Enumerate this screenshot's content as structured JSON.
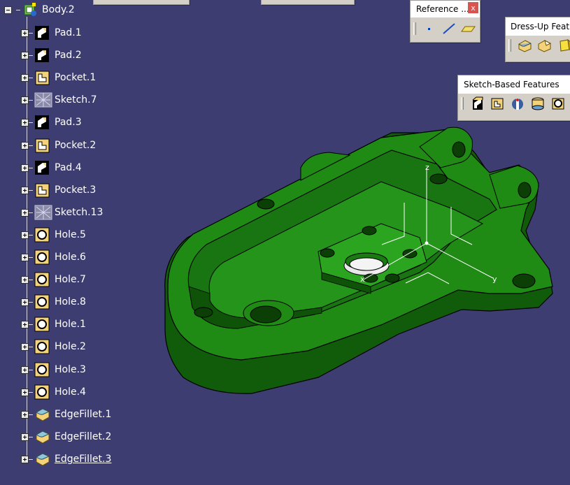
{
  "tree": {
    "root": {
      "label": "Body.2",
      "icon": "body-icon"
    },
    "items": [
      {
        "label": "Pad.1",
        "icon": "pad-icon"
      },
      {
        "label": "Pad.2",
        "icon": "pad-icon"
      },
      {
        "label": "Pocket.1",
        "icon": "pocket-icon"
      },
      {
        "label": "Sketch.7",
        "icon": "sketch-icon"
      },
      {
        "label": "Pad.3",
        "icon": "pad-icon"
      },
      {
        "label": "Pocket.2",
        "icon": "pocket-icon"
      },
      {
        "label": "Pad.4",
        "icon": "pad-icon"
      },
      {
        "label": "Pocket.3",
        "icon": "pocket-icon"
      },
      {
        "label": "Sketch.13",
        "icon": "sketch-icon"
      },
      {
        "label": "Hole.5",
        "icon": "hole-icon"
      },
      {
        "label": "Hole.6",
        "icon": "hole-icon"
      },
      {
        "label": "Hole.7",
        "icon": "hole-icon"
      },
      {
        "label": "Hole.8",
        "icon": "hole-icon"
      },
      {
        "label": "Hole.1",
        "icon": "hole-icon"
      },
      {
        "label": "Hole.2",
        "icon": "hole-icon"
      },
      {
        "label": "Hole.3",
        "icon": "hole-icon"
      },
      {
        "label": "Hole.4",
        "icon": "hole-icon"
      },
      {
        "label": "EdgeFillet.1",
        "icon": "edge-fillet-icon"
      },
      {
        "label": "EdgeFillet.2",
        "icon": "edge-fillet-icon"
      },
      {
        "label": "EdgeFillet.3",
        "icon": "edge-fillet-icon",
        "selected": true
      }
    ]
  },
  "toolbars": {
    "reference": {
      "title": "Reference ...",
      "close": "x",
      "buttons": [
        "point-icon",
        "line-icon",
        "plane-icon"
      ]
    },
    "dressup": {
      "title": "Dress-Up Featur",
      "buttons": [
        "edge-fillet-icon",
        "chamfer-icon",
        "draft-icon"
      ]
    },
    "sketch": {
      "title": "Sketch-Based Features",
      "buttons": [
        "pad-icon",
        "pocket-icon",
        "shaft-icon",
        "hole-icon",
        "rib-icon"
      ]
    }
  },
  "viewport": {
    "axis_labels": {
      "x": "x",
      "y": "y",
      "z": "z"
    },
    "part_color": "#1e7a12",
    "background": "#3d3d72"
  }
}
